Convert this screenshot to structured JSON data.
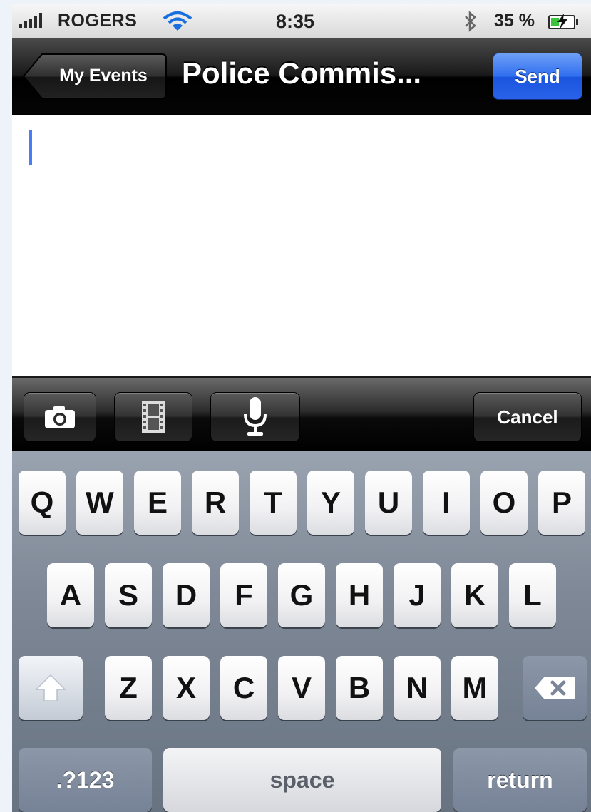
{
  "status_bar": {
    "carrier": "ROGERS",
    "time": "8:35",
    "battery": "35 %",
    "battery_level": 0.35,
    "icons": [
      "signal-icon",
      "wifi-icon",
      "bluetooth-icon",
      "battery-charging-icon"
    ]
  },
  "nav": {
    "back_label": "My Events",
    "title": "Police Commis...",
    "send_label": "Send"
  },
  "compose": {
    "text": ""
  },
  "media_toolbar": {
    "icons": [
      "camera-icon",
      "film-icon",
      "microphone-icon"
    ],
    "cancel_label": "Cancel"
  },
  "keyboard": {
    "row1": [
      "Q",
      "W",
      "E",
      "R",
      "T",
      "Y",
      "U",
      "I",
      "O",
      "P"
    ],
    "row2": [
      "A",
      "S",
      "D",
      "F",
      "G",
      "H",
      "J",
      "K",
      "L"
    ],
    "row3": [
      "Z",
      "X",
      "C",
      "V",
      "B",
      "N",
      "M"
    ],
    "numbers_label": ".?123",
    "space_label": "space",
    "return_label": "return"
  },
  "colors": {
    "send_button": "#2f6ff0",
    "cursor": "#4a7cf7",
    "keyboard_bg": "#7e8896"
  }
}
